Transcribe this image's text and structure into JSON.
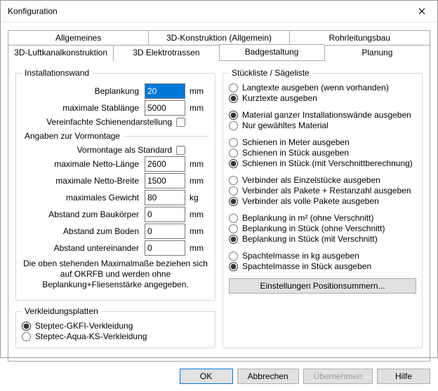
{
  "window": {
    "title": "Konfiguration"
  },
  "tabs_top": [
    "Allgemeines",
    "3D-Konstruktion (Allgemein)",
    "Rohrleitungsbau"
  ],
  "tabs_bot": [
    "3D-Luftkanalkonstruktion",
    "3D Elektrotrassen",
    "Badgestaltung",
    "Planung"
  ],
  "active_tab": "Badgestaltung",
  "left": {
    "group1_title": "Installationswand",
    "beplankung_lbl": "Beplankung",
    "beplankung_val": "20",
    "stablaenge_lbl": "maximale Stablänge",
    "stablaenge_val": "5000",
    "schienen_lbl": "Vereinfachte Schienendarstellung",
    "sub_group_title": "Angaben zur Vormontage",
    "vormontage_lbl": "Vormontage als Standard",
    "netto_l_lbl": "maximale Netto-Länge",
    "netto_l_val": "2600",
    "netto_b_lbl": "maximale Netto-Breite",
    "netto_b_val": "1500",
    "gewicht_lbl": "maximales Gewicht",
    "gewicht_val": "80",
    "abst_bau_lbl": "Abstand zum Baukörper",
    "abst_bau_val": "0",
    "abst_boden_lbl": "Abstand zum Boden",
    "abst_boden_val": "0",
    "abst_unt_lbl": "Abstand untereinander",
    "abst_unt_val": "0",
    "unit_mm": "mm",
    "unit_kg": "kg",
    "note": "Die oben stehenden Maximalmaße beziehen sich auf OKRFB und werden ohne Beplankung+Fliesenstärke angegeben.",
    "group2_title": "Verkleidungsplatten",
    "verk_opt1": "Steptec-GKFI-Verkleidung",
    "verk_opt2": "Steptec-Aqua-KS-Verkleidung"
  },
  "right": {
    "group_title": "Stückliste / Sägeliste",
    "g1": [
      "Langtexte ausgeben (wenn vorhanden)",
      "Kurztexte ausgeben"
    ],
    "g1_sel": 1,
    "g2": [
      "Material ganzer Installationswände ausgeben",
      "Nur gewähltes Material"
    ],
    "g2_sel": 0,
    "g3": [
      "Schienen in Meter ausgeben",
      "Schienen in Stück ausgeben",
      "Schienen in Stück (mit Verschnittberechnung)"
    ],
    "g3_sel": 2,
    "g4": [
      "Verbinder als Einzelstücke ausgeben",
      "Verbinder als Pakete + Restanzahl ausgeben",
      "Verbinder als volle Pakete ausgeben"
    ],
    "g4_sel": 2,
    "g5": [
      "Beplankung in m² (ohne Verschnitt)",
      "Beplankung in Stück (ohne Verschnitt)",
      "Beplankung in Stück (mit Verschnitt)"
    ],
    "g5_sel": 2,
    "g6": [
      "Spachtelmasse in kg ausgeben",
      "Spachtelmasse in Stück ausgeben"
    ],
    "g6_sel": 1,
    "btn_posnum": "Einstellungen Positionsummern..."
  },
  "footer": {
    "ok": "OK",
    "cancel": "Abbrechen",
    "apply": "Übernehmen",
    "help": "Hilfe"
  }
}
